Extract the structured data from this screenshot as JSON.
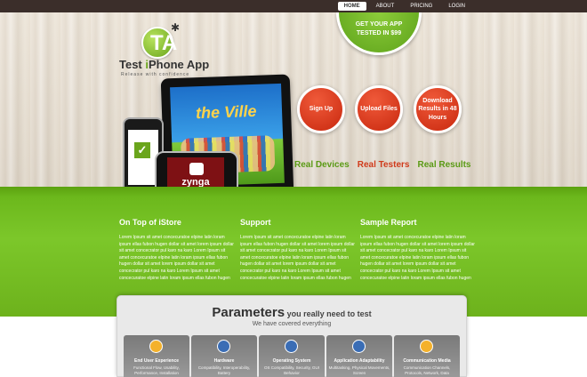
{
  "nav": {
    "items": [
      {
        "label": "HOME",
        "active": true
      },
      {
        "label": "ABOUT",
        "active": false
      },
      {
        "label": "PRICING",
        "active": false
      },
      {
        "label": "LOGIN",
        "active": false
      }
    ]
  },
  "logo": {
    "letter": "TA",
    "title_prefix": "Test ",
    "title_i": "i",
    "title_suffix": "Phone App",
    "tagline": "Release with confidence"
  },
  "ribbon": {
    "line1": "GET YOUR APP",
    "line2": "TESTED IN $99"
  },
  "actions": [
    {
      "label": "Sign Up"
    },
    {
      "label": "Upload Files"
    },
    {
      "label": "Download Results in 48 Hours"
    }
  ],
  "taglines": [
    {
      "text": "Real Devices",
      "color": "#5a9a15"
    },
    {
      "text": "Real Testers",
      "color": "#d03a1a"
    },
    {
      "text": "Real Results",
      "color": "#5a9a15"
    }
  ],
  "devices": {
    "ipad_game": "the Ville",
    "iphone_front_game": "zynga"
  },
  "columns": [
    {
      "title": "On Top of iStore",
      "body": "Lorem Ipsum sit amet concecuratoe elpine latin loram ipsum ellas fubon hugen dollar sit amet lorem ipsum dollar sit amet concecrator pul karo na karo Lorem Ipsum sit amet concecuratoe elpine latin loram ipsum ellas fubon hugen dollar sit amet lorem ipsum dollar sit amet concecrator pul karo na karo Lorem Ipsum sit amet concecuratoe elpine latin loram ipsum ellas fubon hugen"
    },
    {
      "title": "Support",
      "body": "Lorem Ipsum sit amet concecuratoe elpine latin loram ipsum ellas fubon hugen dollar sit amet lorem ipsum dollar sit amet concecrator pul karo na karo Lorem Ipsum sit amet concecuratoe elpine latin loram ipsum ellas fubon hugen dollar sit amet lorem ipsum dollar sit amet concecrator pul karo na karo Lorem Ipsum sit amet concecuratoe elpine latin loram ipsum ellas fubon hugen"
    },
    {
      "title": "Sample Report",
      "body": "Lorem Ipsum sit amet concecuratoe elpine latin loram ipsum ellas fubon hugen dollar sit amet lorem ipsum dollar sit amet concecrator pul karo na karo Lorem Ipsum sit amet concecuratoe elpine latin loram ipsum ellas fubon hugen dollar sit amet lorem ipsum dollar sit amet concecrator pul karo na karo Lorem Ipsum sit amet concecuratoe elpine latin loram ipsum ellas fubon hugen"
    }
  ],
  "parameters": {
    "title_big": "Parameters",
    "title_rest": " you really need to test",
    "subtitle": "We have covered everything",
    "cards": [
      {
        "title": "End User Experience",
        "desc": "Functional Flow, Usability, Performance, Installation",
        "icon": "user-icon"
      },
      {
        "title": "Hardware",
        "desc": "Compatibility, Interoperability, Battery",
        "icon": "hardware-icon"
      },
      {
        "title": "Operating System",
        "desc": "OS Compatibility, Security, GUI Behavior",
        "icon": "os-icon"
      },
      {
        "title": "Application Adaptability",
        "desc": "Multitasking, Physical Movements, Screen",
        "icon": "adaptability-icon"
      },
      {
        "title": "Communication Media",
        "desc": "Communication Channels, Protocols, Network, Data",
        "icon": "media-icon"
      }
    ]
  }
}
